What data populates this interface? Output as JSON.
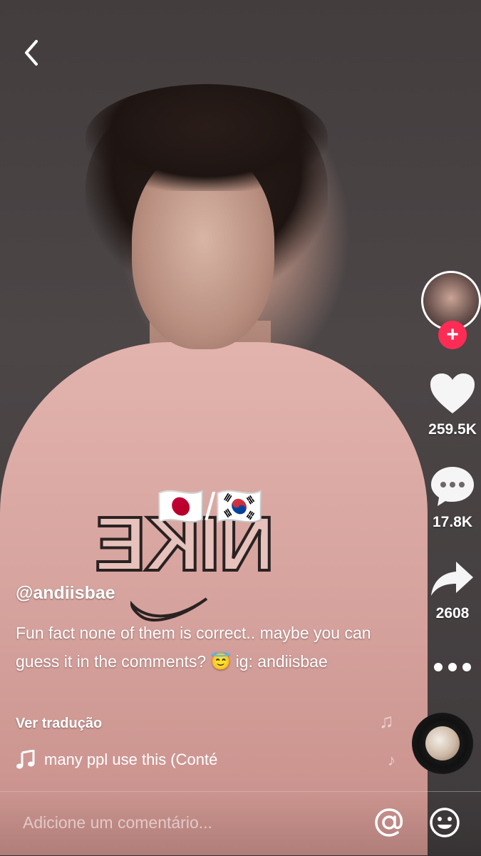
{
  "video": {
    "username": "@andiisbae",
    "caption": "Fun fact none of them is correct.. maybe you can guess it in the comments? 😇 ig: andiisbae",
    "flags_overlay": "🇯🇵/🇰🇷",
    "translate_label": "Ver tradução",
    "music_label": "many ppl use this (Conté"
  },
  "actions": {
    "likes": "259.5K",
    "comments": "17.8K",
    "shares": "2608",
    "follow_symbol": "+"
  },
  "comment_bar": {
    "placeholder": "Adicione um comentário..."
  },
  "icons": {
    "back": "chevron-left-icon",
    "like": "heart-icon",
    "comment": "speech-bubble-icon",
    "share": "share-arrow-icon",
    "more": "more-dots-icon",
    "music": "music-note-icon",
    "mention": "at-sign-icon",
    "emoji": "smiley-icon"
  },
  "colors": {
    "accent": "#fe2c55",
    "text": "#ffffff"
  }
}
